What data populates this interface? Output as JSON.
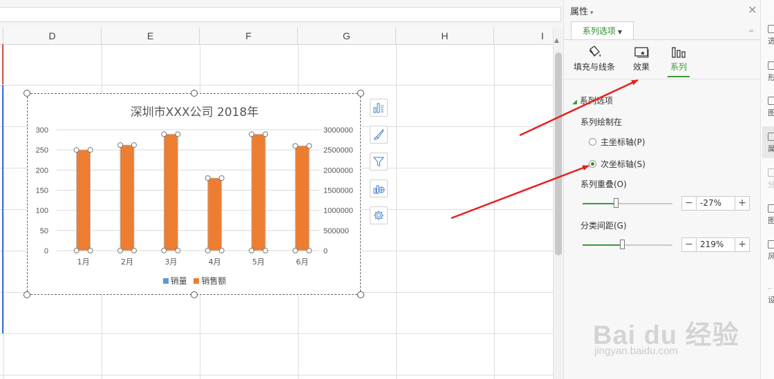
{
  "sheet": {
    "columns": [
      "D",
      "E",
      "F",
      "G",
      "H",
      "I"
    ]
  },
  "chart": {
    "title": "深圳市XXX公司   2018年",
    "legend": [
      {
        "label": "销量",
        "color": "#5b9bd5"
      },
      {
        "label": "销售额",
        "color": "#ed7d31"
      }
    ],
    "tools": [
      "chart-elements-icon",
      "chart-style-icon",
      "chart-filter-icon",
      "chart-type-icon",
      "chart-settings-icon"
    ]
  },
  "chart_data": {
    "type": "bar",
    "title": "深圳市XXX公司   2018年",
    "categories": [
      "1月",
      "2月",
      "3月",
      "4月",
      "5月",
      "6月"
    ],
    "series": [
      {
        "name": "销量",
        "axis": "primary",
        "color": "#5b9bd5",
        "values": [
          0,
          0,
          0,
          0,
          0,
          0
        ]
      },
      {
        "name": "销售额",
        "axis": "secondary",
        "color": "#ed7d31",
        "values": [
          2500000,
          2620000,
          2890000,
          1800000,
          2890000,
          2600000
        ]
      }
    ],
    "y_ticks": [
      "0",
      "50",
      "100",
      "150",
      "200",
      "250",
      "300"
    ],
    "ylim": [
      0,
      300
    ],
    "y2_ticks": [
      "0",
      "500000",
      "1000000",
      "1500000",
      "2000000",
      "2500000",
      "3000000"
    ],
    "y2lim": [
      0,
      3000000
    ],
    "grid": true,
    "legend_position": "bottom"
  },
  "panel": {
    "title": "属性",
    "close": "×",
    "series_tab": "系列选项",
    "sub_tabs": [
      {
        "label": "填充与线条",
        "icon": "fill-bucket-icon"
      },
      {
        "label": "效果",
        "icon": "effects-icon"
      },
      {
        "label": "系列",
        "icon": "series-bars-icon"
      }
    ],
    "section": "系列选项",
    "plot_on_label": "系列绘制在",
    "radio_primary": "主坐标轴(P)",
    "radio_secondary": "次坐标轴(S)",
    "overlap_label": "系列重叠(O)",
    "overlap_value": "-27%",
    "overlap_fraction": 0.37,
    "gap_label": "分类间距(G)",
    "gap_value": "219%",
    "gap_fraction": 0.44,
    "minus": "−",
    "plus": "+"
  },
  "right_toolbar": [
    "选",
    "形",
    "图",
    "属",
    "分",
    "图",
    "风",
    "设"
  ],
  "watermark": {
    "main": "Bai du 经验",
    "url": "jingyan.baidu.com"
  },
  "colors": {
    "accent_green": "#3a9a3a",
    "bar_orange": "#ed7d31",
    "arrow_red": "#e8201c"
  }
}
